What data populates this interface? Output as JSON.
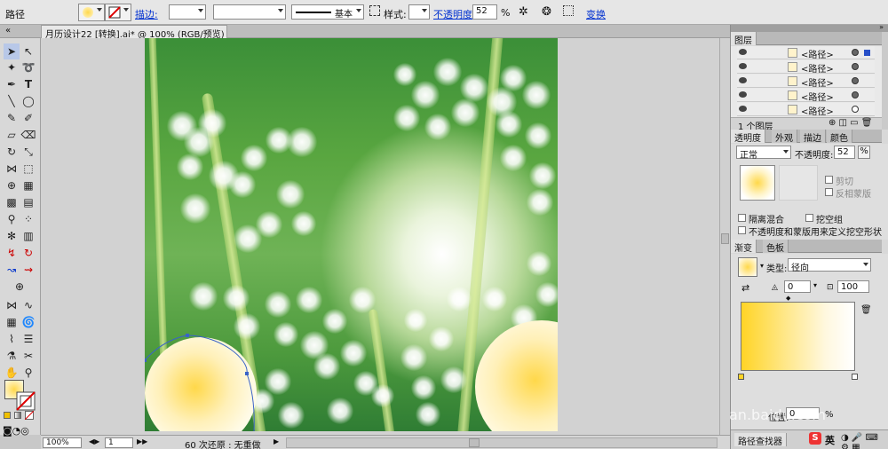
{
  "control_bar": {
    "object_type": "路径",
    "stroke_link": "描边:",
    "stroke_profile": "基本",
    "style_label": "样式:",
    "opacity_link": "不透明度",
    "opacity_value": "52",
    "opacity_unit": "%",
    "transform_link": "变换"
  },
  "document_tab": {
    "title": "月历设计22 [转换].ai* @ 100% (RGB/预览)",
    "close_glyph": "⊠"
  },
  "status_bar": {
    "zoom": "100%",
    "page": "1",
    "info": "60 次还原 : 无重做"
  },
  "layers_panel": {
    "tab_label": "图层",
    "rows": [
      {
        "name": "<路径>"
      },
      {
        "name": "<路径>"
      },
      {
        "name": "<路径>"
      },
      {
        "name": "<路径>"
      },
      {
        "name": "<路径>"
      }
    ],
    "footer_count": "1 个图层"
  },
  "transparency_panel": {
    "tabs": [
      "透明度",
      "外观",
      "描边",
      "颜色"
    ],
    "blend_mode": "正常",
    "opacity_label": "不透明度:",
    "opacity_value": "52",
    "opacity_unit": "%",
    "clip_label": "剪切",
    "invert_mask_label": "反相蒙版",
    "isolate_blend_label": "隔离混合",
    "knockout_group_label": "挖空组",
    "opacity_mask_label": "不透明度和蒙版用来定义挖空形状"
  },
  "gradient_panel": {
    "tabs": [
      "渐变",
      "色板"
    ],
    "type_label": "类型:",
    "type_value": "径向",
    "angle_value": "0",
    "aspect_value": "100",
    "position_label": "位置:",
    "position_value": "0",
    "percent": "%"
  },
  "bottom_panel": {
    "tab_label": "路径查找器"
  },
  "watermark": {
    "text": "an.baidu.com"
  },
  "ime": {
    "lang": "英"
  },
  "colors": {
    "link": "#0030d0",
    "selection": "#3a63c8",
    "gradient_start": "#ffd426",
    "gradient_end": "#ffffff"
  }
}
